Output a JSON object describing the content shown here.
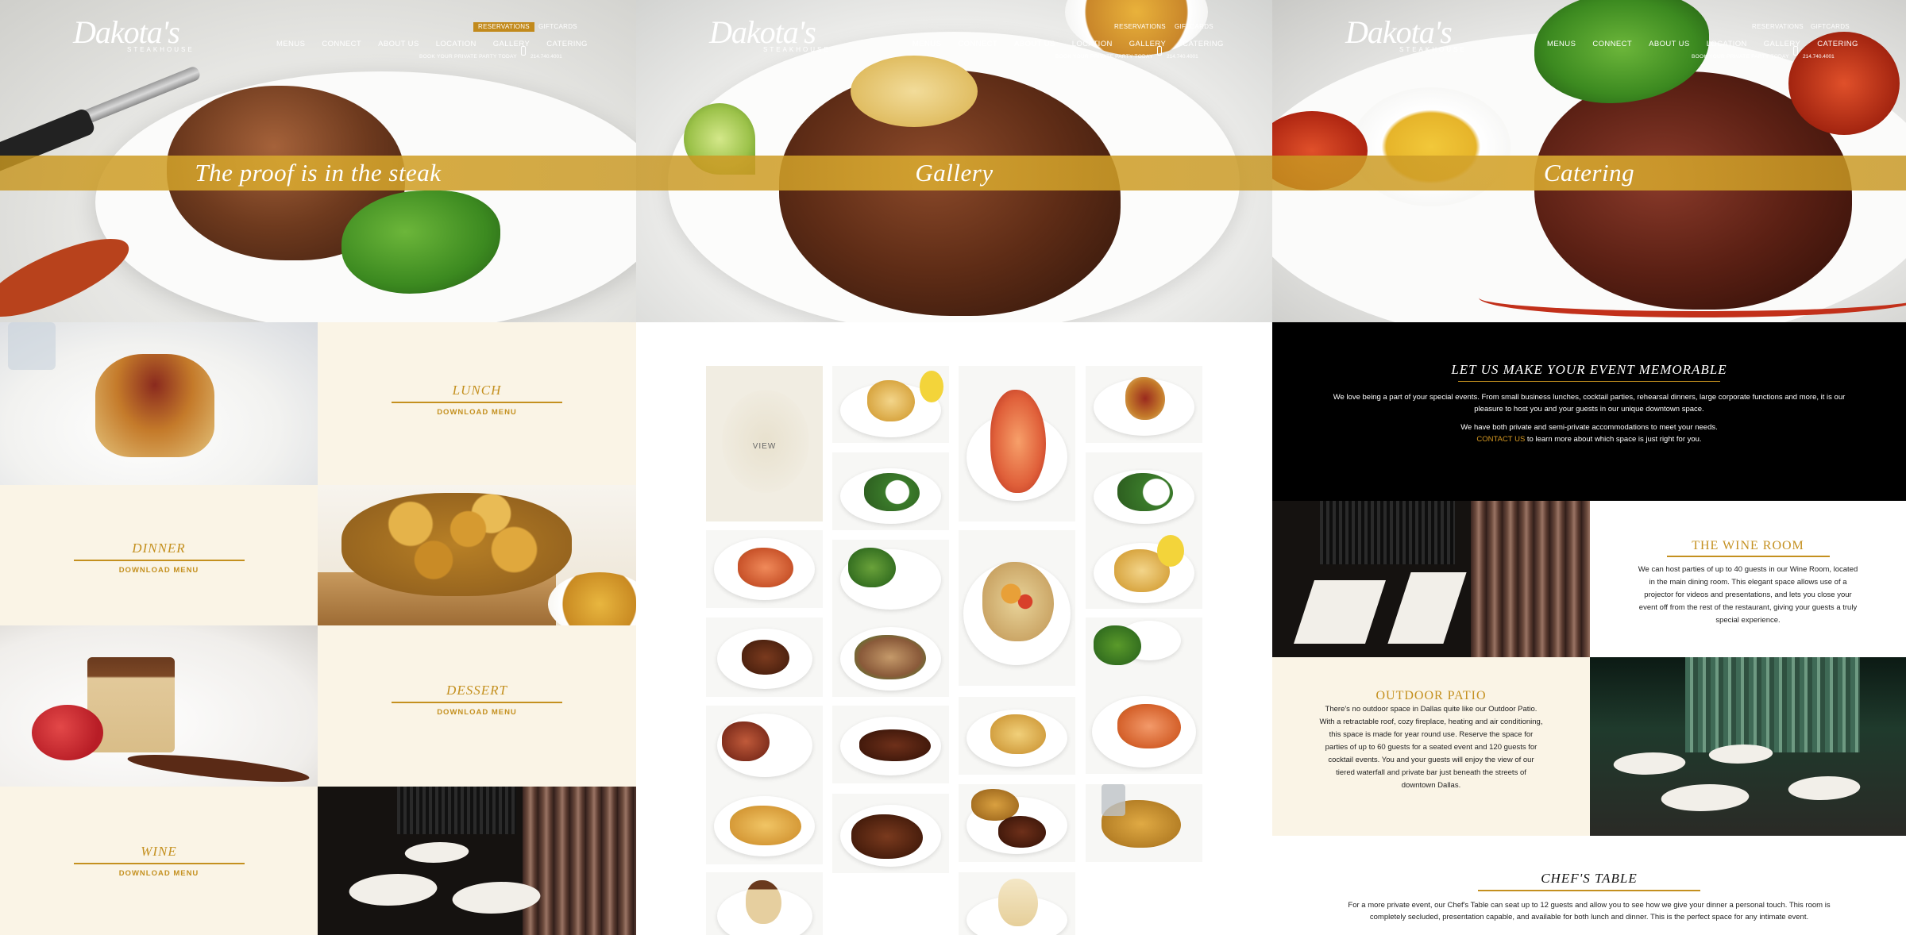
{
  "brand": {
    "logo_script": "Dakota's",
    "logo_sub": "STEAKHOUSE",
    "gold": "#c4901f"
  },
  "header": {
    "reservations": "RESERVATIONS",
    "giftcards": "GIFTCARDS",
    "nav": [
      "MENUS",
      "CONNECT",
      "ABOUT US",
      "LOCATION",
      "GALLERY",
      "CATERING"
    ],
    "private_party": "BOOK YOUR PRIVATE PARTY TODAY",
    "phone": "214.740.4001",
    "phone_icon": "phone-icon"
  },
  "menus_page": {
    "hero_title": "The proof is in the steak",
    "menus": [
      {
        "title": "LUNCH",
        "link": "DOWNLOAD MENU"
      },
      {
        "title": "DINNER",
        "link": "DOWNLOAD MENU"
      },
      {
        "title": "DESSERT",
        "link": "DOWNLOAD MENU"
      },
      {
        "title": "WINE",
        "link": "DOWNLOAD MENU"
      }
    ]
  },
  "gallery_page": {
    "hero_title": "Gallery",
    "view_label": "VIEW"
  },
  "catering_page": {
    "hero_title": "Catering",
    "intro_heading": "LET US MAKE YOUR EVENT MEMORABLE",
    "intro_p1": "We love being a part of your special events. From small business lunches, cocktail parties, rehearsal dinners, large corporate functions and more, it is our pleasure to host you and your guests in our unique downtown space.",
    "intro_p2_line1": "We have both private and semi-private accommodations to meet your needs.",
    "intro_link": "CONTACT US",
    "intro_p2_line2": "to learn more about which space is just right for you.",
    "wine_room": {
      "title": "THE WINE ROOM",
      "text": "We can host parties of up to 40 guests in our Wine Room, located in the main dining room. This elegant space allows use of a projector for videos and presentations, and lets you close your event off from the rest of the restaurant, giving your guests a truly special experience."
    },
    "outdoor_patio": {
      "title": "OUTDOOR PATIO",
      "text": "There's no outdoor space in Dallas quite like our Outdoor Patio. With a retractable roof, cozy fireplace, heating and air conditioning, this space is made for year round use. Reserve the space for parties of up to 60 guests for a seated event and 120 guests for cocktail events. You and your guests will enjoy the view of our tiered waterfall and private bar just beneath the streets of downtown Dallas."
    },
    "chefs_table": {
      "title": "CHEF'S TABLE",
      "text": "For a more private event, our Chef's Table can seat up to 12 guests and allow you to see how we give your dinner a personal touch. This room is completely secluded, presentation capable, and available for both lunch and dinner. This is the perfect space for any intimate event."
    }
  }
}
